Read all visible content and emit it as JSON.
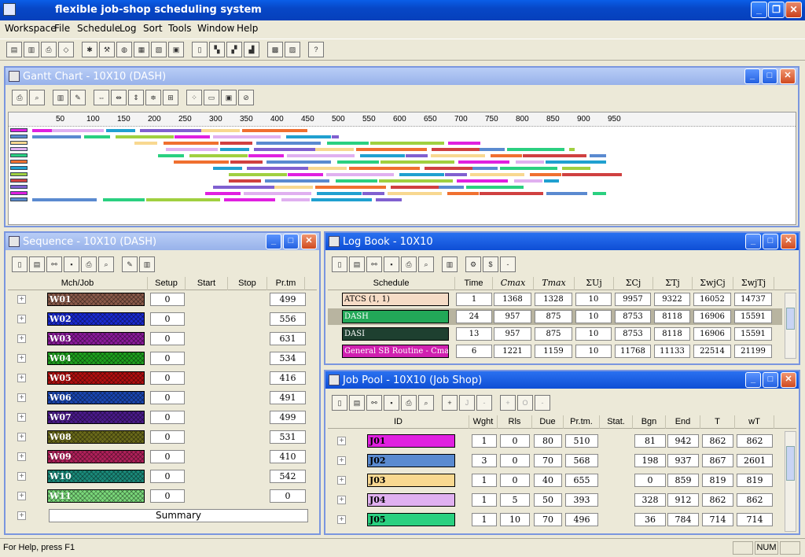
{
  "app": {
    "title": "flexible job-shop scheduling system"
  },
  "menu": [
    "Workspace",
    "File",
    "Schedule",
    "Log",
    "Sort",
    "Tools",
    "Window",
    "Help"
  ],
  "gantt": {
    "title": "Gantt Chart - 10X10 (DASH)",
    "ticks": [
      "50",
      "100",
      "150",
      "200",
      "250",
      "300",
      "350",
      "400",
      "450",
      "500",
      "550",
      "600",
      "650",
      "700",
      "750",
      "800",
      "850",
      "900",
      "950"
    ]
  },
  "sequence": {
    "title": "Sequence - 10X10 (DASH)",
    "headers": [
      "Mch/Job",
      "Setup",
      "Start",
      "Stop",
      "Pr.tm"
    ],
    "rows": [
      {
        "id": "W01",
        "setup": "0",
        "prtm": "499",
        "color": "#8a5a4a"
      },
      {
        "id": "W02",
        "setup": "0",
        "prtm": "556",
        "color": "#1a2ad0"
      },
      {
        "id": "W03",
        "setup": "0",
        "prtm": "631",
        "color": "#8a1a9a"
      },
      {
        "id": "W04",
        "setup": "0",
        "prtm": "534",
        "color": "#1ea01e"
      },
      {
        "id": "W05",
        "setup": "0",
        "prtm": "416",
        "color": "#b01010"
      },
      {
        "id": "W06",
        "setup": "0",
        "prtm": "491",
        "color": "#1a46b0"
      },
      {
        "id": "W07",
        "setup": "0",
        "prtm": "499",
        "color": "#4a1a8a"
      },
      {
        "id": "W08",
        "setup": "0",
        "prtm": "531",
        "color": "#6a6a1a"
      },
      {
        "id": "W09",
        "setup": "0",
        "prtm": "410",
        "color": "#b0205a"
      },
      {
        "id": "W10",
        "setup": "0",
        "prtm": "542",
        "color": "#1a8a7a"
      },
      {
        "id": "W11",
        "setup": "0",
        "prtm": "0",
        "color": "#7ad87a"
      }
    ],
    "summary": "Summary"
  },
  "logbook": {
    "title": "Log Book - 10X10",
    "headers": [
      "Schedule",
      "Time",
      "Cmax",
      "Tmax",
      "ΣUj",
      "ΣCj",
      "ΣTj",
      "ΣwjCj",
      "ΣwjTj"
    ],
    "rows": [
      {
        "name": "ATCS (1, 1)",
        "time": "1",
        "cmax": "1368",
        "tmax": "1328",
        "u": "10",
        "c": "9957",
        "t": "9322",
        "wc": "16052",
        "wt": "14737",
        "color": "#f6dcc6",
        "fg": "#000"
      },
      {
        "name": "DASH",
        "time": "24",
        "cmax": "957",
        "tmax": "875",
        "u": "10",
        "c": "8753",
        "t": "8118",
        "wc": "16906",
        "wt": "15591",
        "color": "#22a858",
        "fg": "#fff"
      },
      {
        "name": "DASI",
        "time": "13",
        "cmax": "957",
        "tmax": "875",
        "u": "10",
        "c": "8753",
        "t": "8118",
        "wc": "16906",
        "wt": "15591",
        "color": "#1e4030",
        "fg": "#fff"
      },
      {
        "name": "General SB Routine - Cmax",
        "time": "6",
        "cmax": "1221",
        "tmax": "1159",
        "u": "10",
        "c": "11768",
        "t": "11133",
        "wc": "22514",
        "wt": "21199",
        "color": "#d020b0",
        "fg": "#fff"
      }
    ]
  },
  "jobpool": {
    "title": "Job Pool - 10X10 (Job Shop)",
    "headers": [
      "ID",
      "Wght",
      "Rls",
      "Due",
      "Pr.tm.",
      "Stat.",
      "Bgn",
      "End",
      "T",
      "wT"
    ],
    "rows": [
      {
        "id": "J01",
        "w": "1",
        "r": "0",
        "d": "80",
        "p": "510",
        "b": "81",
        "e": "942",
        "t": "862",
        "wt": "862",
        "color": "#e020e0"
      },
      {
        "id": "J02",
        "w": "3",
        "r": "0",
        "d": "70",
        "p": "568",
        "b": "198",
        "e": "937",
        "t": "867",
        "wt": "2601",
        "color": "#5a8ad0"
      },
      {
        "id": "J03",
        "w": "1",
        "r": "0",
        "d": "40",
        "p": "655",
        "b": "0",
        "e": "859",
        "t": "819",
        "wt": "819",
        "color": "#f8d890"
      },
      {
        "id": "J04",
        "w": "1",
        "r": "5",
        "d": "50",
        "p": "393",
        "b": "328",
        "e": "912",
        "t": "862",
        "wt": "862",
        "color": "#e0b0f0"
      },
      {
        "id": "J05",
        "w": "1",
        "r": "10",
        "d": "70",
        "p": "496",
        "b": "36",
        "e": "784",
        "t": "714",
        "wt": "714",
        "color": "#2ad080"
      }
    ]
  },
  "status": {
    "help": "For Help, press F1",
    "num": "NUM"
  }
}
